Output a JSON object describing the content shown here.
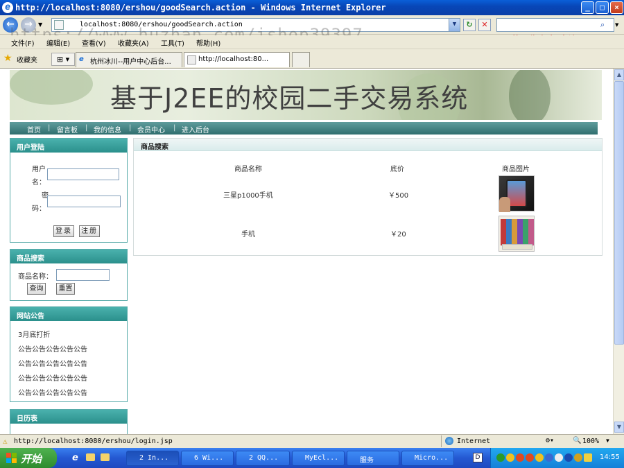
{
  "window": {
    "title": "http://localhost:8080/ershou/goodSearch.action - Windows Internet Explorer",
    "buttons": {
      "minimize": "_",
      "maximize": "□",
      "close": "×"
    }
  },
  "address_bar": {
    "url": "localhost:8080/ershou/goodSearch.action",
    "watermark": "https://www.huzhan.com/ishop39397",
    "overlay_text": "屏幕录像专家 未注册"
  },
  "menu": [
    "文件(F)",
    "编辑(E)",
    "查看(V)",
    "收藏夹(A)",
    "工具(T)",
    "帮助(H)"
  ],
  "favorites_label": "收藏夹",
  "tabs": [
    {
      "label": "杭州冰川--用户中心后台..."
    },
    {
      "label": "http://localhost:80..."
    }
  ],
  "site": {
    "banner_title": "基于J2EE的校园二手交易系统",
    "nav": [
      "首页",
      "留言板",
      "我的信息",
      "会员中心",
      "进入后台"
    ],
    "nav_separator": "|"
  },
  "login_box": {
    "title": "用户登陆",
    "username_label_1": "用户",
    "username_label_2": "名：",
    "password_label_1": "密",
    "password_label_2": "码：",
    "login_button": "登录",
    "register_button": "注册"
  },
  "search_box": {
    "title": "商品搜索",
    "name_label": "商品名称：",
    "query_button": "查询",
    "reset_button": "重置"
  },
  "notice_box": {
    "title": "网站公告",
    "items": [
      "3月底打折",
      "公告公告公告公告公告",
      "公告公告公告公告公告",
      "公告公告公告公告公告",
      "公告公告公告公告公告"
    ]
  },
  "calendar_box": {
    "title": "日历表"
  },
  "results": {
    "title": "商品搜索",
    "headers": [
      "商品名称",
      "底价",
      "商品图片"
    ],
    "rows": [
      {
        "name": "三星p1000手机",
        "price": "￥500",
        "image": "phone-photo"
      },
      {
        "name": "手机",
        "price": "￥20",
        "image": "books-photo"
      }
    ]
  },
  "status_bar": {
    "url": "http://localhost:8080/ershou/login.jsp",
    "zone": "Internet",
    "zoom": "100%"
  },
  "taskbar": {
    "start": "开始",
    "items": [
      "2 In...",
      "6 Wi...",
      "2 QQ...",
      "MyEcl...",
      "服务",
      "Micro..."
    ],
    "clock": "14:55"
  }
}
